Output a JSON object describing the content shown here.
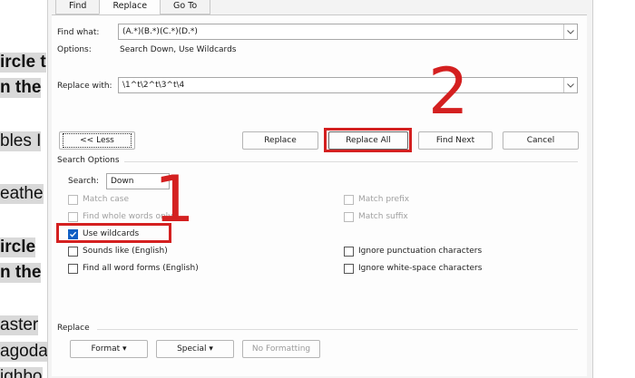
{
  "document_fragments": [
    {
      "text": "ircle t",
      "style": "bold hl"
    },
    {
      "text": "n the",
      "style": "bold hl"
    },
    {
      "text": "bles I",
      "style": "hl"
    },
    {
      "text": "eathe",
      "style": "hl"
    },
    {
      "text": "ircle",
      "style": "bold hl"
    },
    {
      "text": "n the",
      "style": "bold hl"
    },
    {
      "text": "aster",
      "style": "hl"
    },
    {
      "text": "agoda",
      "style": "hl"
    },
    {
      "text": "ighbo",
      "style": "hl"
    }
  ],
  "tabs": [
    {
      "label": "Find",
      "active": false
    },
    {
      "label": "Replace",
      "active": true
    },
    {
      "label": "Go To",
      "active": false
    }
  ],
  "find": {
    "label": "Find what:",
    "value": "(A.*)(B.*)(C.*)(D.*)",
    "options_label": "Options:",
    "options_value": "Search Down, Use Wildcards"
  },
  "replace": {
    "label": "Replace with:",
    "value": "\\1^t\\2^t\\3^t\\4"
  },
  "buttons": {
    "less": "<< Less",
    "replace": "Replace",
    "replace_all": "Replace All",
    "find_next": "Find Next",
    "cancel": "Cancel"
  },
  "search_options": {
    "title": "Search Options",
    "search_label": "Search:",
    "search_value": "Down",
    "left_options": [
      {
        "label": "Match case",
        "checked": false,
        "enabled": false
      },
      {
        "label": "Find whole words only",
        "checked": false,
        "enabled": false
      },
      {
        "label": "Use wildcards",
        "checked": true,
        "enabled": true
      },
      {
        "label": "Sounds like (English)",
        "checked": false,
        "enabled": true
      },
      {
        "label": "Find all word forms (English)",
        "checked": false,
        "enabled": true
      }
    ],
    "right_options": [
      {
        "label": "Match prefix",
        "checked": false,
        "enabled": false
      },
      {
        "label": "Match suffix",
        "checked": false,
        "enabled": false
      },
      {
        "label": "Ignore punctuation characters",
        "checked": false,
        "enabled": true
      },
      {
        "label": "Ignore white-space characters",
        "checked": false,
        "enabled": true
      }
    ]
  },
  "replace_section": {
    "title": "Replace",
    "format_button": "Format",
    "special_button": "Special",
    "no_formatting_button": "No Formatting"
  },
  "annotations": {
    "step1": "1",
    "step2": "2",
    "color": "#d42020"
  },
  "colors": {
    "checkbox_checked": "#0f5fc4",
    "dialog_bg": "#f3f3f3"
  }
}
